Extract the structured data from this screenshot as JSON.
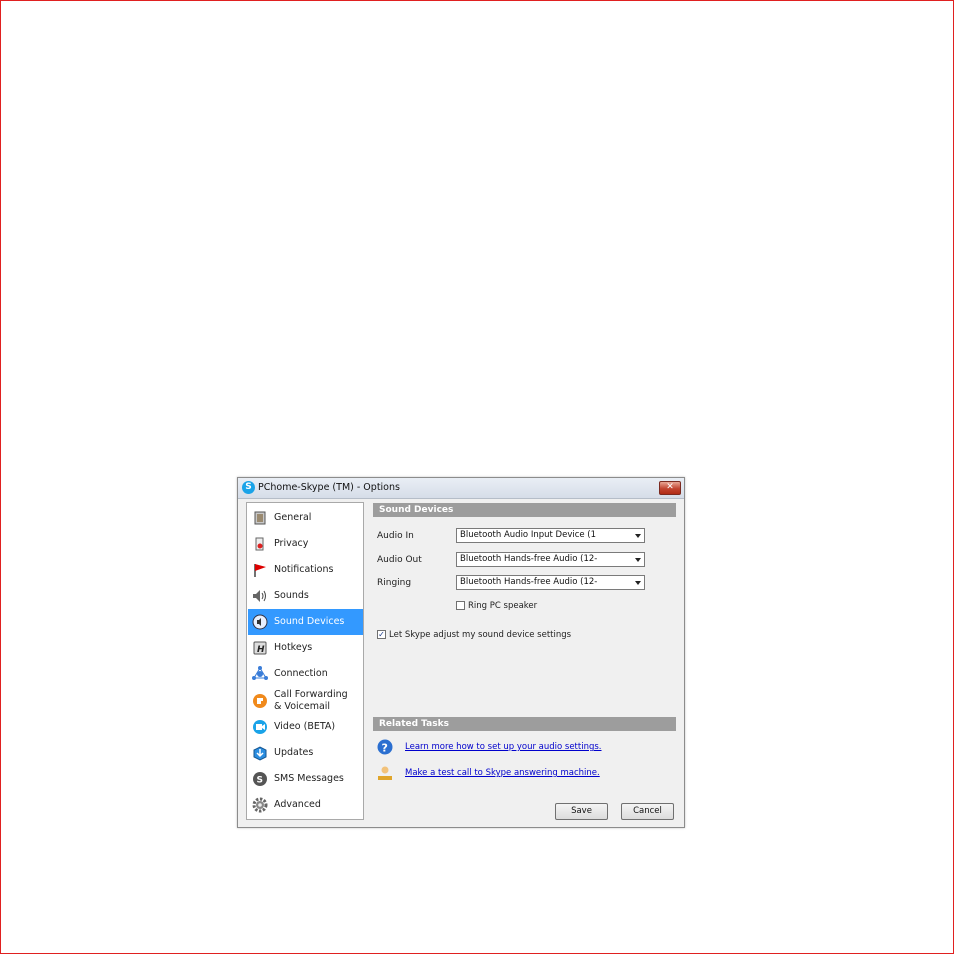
{
  "window": {
    "title": "PChome-Skype (TM) - Options",
    "close_glyph": "✕"
  },
  "sidebar": {
    "items": [
      {
        "label": "General",
        "icon": "general-icon"
      },
      {
        "label": "Privacy",
        "icon": "privacy-icon"
      },
      {
        "label": "Notifications",
        "icon": "notifications-flag-icon"
      },
      {
        "label": "Sounds",
        "icon": "sounds-speaker-icon"
      },
      {
        "label": "Sound Devices",
        "icon": "sound-devices-icon",
        "selected": true
      },
      {
        "label": "Hotkeys",
        "icon": "hotkeys-icon"
      },
      {
        "label": "Connection",
        "icon": "connection-icon"
      },
      {
        "label": "Call Forwarding",
        "label2": "& Voicemail",
        "icon": "call-forwarding-icon"
      },
      {
        "label": "Video (BETA)",
        "icon": "video-icon"
      },
      {
        "label": "Updates",
        "icon": "updates-icon"
      },
      {
        "label": "SMS Messages",
        "icon": "sms-icon"
      },
      {
        "label": "Advanced",
        "icon": "advanced-gear-icon"
      }
    ],
    "selected_color": "#3399ff"
  },
  "sound_devices": {
    "header": "Sound Devices",
    "audio_in_label": "Audio In",
    "audio_in_value": "Bluetooth Audio Input Device (1",
    "audio_out_label": "Audio Out",
    "audio_out_value": "Bluetooth Hands-free Audio (12-",
    "ringing_label": "Ringing",
    "ringing_value": "Bluetooth Hands-free Audio (12-",
    "ring_pc_label": "Ring PC speaker",
    "ring_pc_checked": false,
    "auto_adjust_label": "Let Skype adjust my sound device settings",
    "auto_adjust_checked": true
  },
  "related_tasks": {
    "header": "Related Tasks",
    "learn_link": "Learn more how to set up your audio settings.",
    "test_call_link": "Make a test call to Skype answering machine."
  },
  "buttons": {
    "save": "Save",
    "cancel": "Cancel"
  },
  "colors": {
    "header_bg": "#9d9d9d",
    "link": "#0000cc",
    "page_border": "#e02020"
  }
}
